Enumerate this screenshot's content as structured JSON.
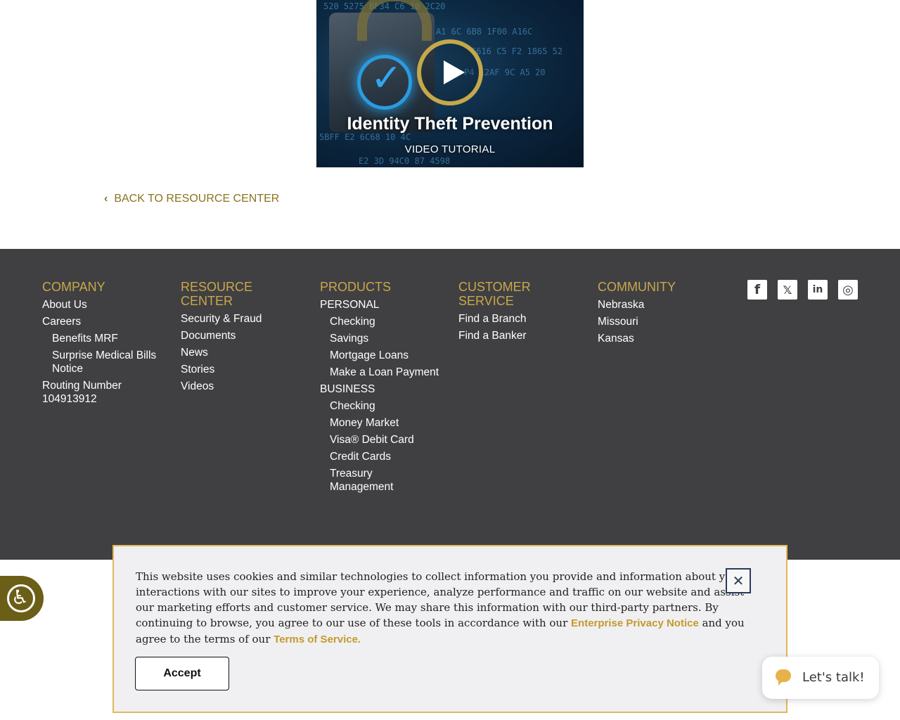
{
  "video": {
    "title": "Identity Theft Prevention",
    "subtitle": "VIDEO TUTORIAL",
    "hex_lines": [
      "520  5275  BF34  C6  10  2C20",
      "A1  6C  6B8  1F00  A16C",
      "F616  C5  F2  1865  52",
      "P4  12AF  9C  A5  20",
      "5BFF  E2  6C68  10  4C",
      "E2 3D  94C0  87  4598"
    ]
  },
  "back_link": {
    "label": "BACK TO RESOURCE CENTER"
  },
  "footer": {
    "company": {
      "heading": "COMPANY",
      "items": [
        "About Us",
        "Careers"
      ],
      "sub_items": [
        "Benefits MRF",
        "Surprise Medical Bills Notice"
      ],
      "routing_label": "Routing Number",
      "routing_number": "104913912"
    },
    "resource_center": {
      "heading": "RESOURCE CENTER",
      "items": [
        "Security & Fraud",
        "Documents",
        "News",
        "Stories",
        "Videos"
      ]
    },
    "products": {
      "heading": "PRODUCTS",
      "personal_label": "PERSONAL",
      "personal_items": [
        "Checking",
        "Savings",
        "Mortgage Loans",
        "Make a Loan Payment"
      ],
      "business_label": "BUSINESS",
      "business_items": [
        "Checking",
        "Money Market",
        "Visa® Debit Card",
        "Credit Cards",
        "Treasury Management"
      ]
    },
    "customer_service": {
      "heading": "CUSTOMER SERVICE",
      "items": [
        "Find a Branch",
        "Find a Banker"
      ]
    },
    "community": {
      "heading": "COMMUNITY",
      "items": [
        "Nebraska",
        "Missouri",
        "Kansas"
      ]
    },
    "social": [
      {
        "icon": "facebook-icon",
        "glyph": "f"
      },
      {
        "icon": "x-twitter-icon",
        "glyph": "𝕏"
      },
      {
        "icon": "linkedin-icon",
        "glyph": "in"
      },
      {
        "icon": "instagram-icon",
        "glyph": "◎"
      }
    ]
  },
  "cookie": {
    "text_before": "This website uses cookies and similar technologies to collect information you provide and information about your interactions with our sites to improve your experience, analyze performance and traffic on our website and assist our marketing efforts and customer service. We may share this information with our third-party partners. By continuing to browse, you agree to our use of these tools in accordance with our ",
    "privacy_link": "Enterprise Privacy Notice",
    "text_middle": " and you agree to the terms of our ",
    "terms_link": "Terms of Service.",
    "close_label": "✕",
    "accept_label": "Accept"
  },
  "chat": {
    "label": "Let's talk!"
  },
  "colors": {
    "accent_gold": "#c8a84a",
    "footer_bg": "#404043",
    "a11y_bg": "#6b5e17"
  }
}
